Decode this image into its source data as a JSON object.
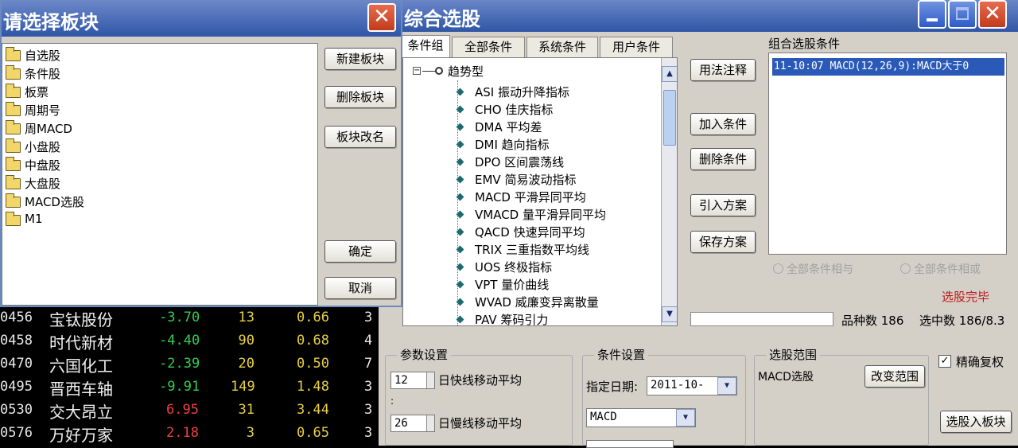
{
  "board_dialog": {
    "title": "请选择板块",
    "close_glyph": "✕",
    "folders": [
      "自选股",
      "条件股",
      "板票",
      "周期号",
      "周MACD",
      "小盘股",
      "中盘股",
      "大盘股",
      "MACD选股",
      "M1"
    ],
    "buttons": {
      "new": "新建板块",
      "delete": "删除板块",
      "rename": "板块改名",
      "ok": "确定",
      "cancel": "取消"
    }
  },
  "main_window": {
    "title": "综合选股",
    "tabs": [
      "条件组",
      "全部条件",
      "系统条件",
      "用户条件"
    ],
    "tree_root": "趋势型",
    "tree_items": [
      "ASI 振动升降指标",
      "CHO 佳庆指标",
      "DMA 平均差",
      "DMI 趋向指标",
      "DPO 区间震荡线",
      "EMV 简易波动指标",
      "MACD 平滑异同平均",
      "VMACD 量平滑异同平均",
      "QACD 快速异同平均",
      "TRIX 三重指数平均线",
      "UOS 终极指标",
      "VPT 量价曲线",
      "WVAD 威廉变异离散量",
      "PAV 筹码引力"
    ],
    "buttons": {
      "usage": "用法注释",
      "add_condition": "加入条件",
      "delete_condition": "删除条件",
      "import_plan": "引入方案",
      "save_plan": "保存方案"
    },
    "combo_label": "组合选股条件",
    "combo_items": [
      "11-10:07 MACD(12,26,9):MACD大于0"
    ],
    "radio_and": "全部条件相与",
    "radio_or": "全部条件相或",
    "select_done": "选股完毕",
    "stock_count": "品种数 186",
    "selected_count": "选中数 186/8.3",
    "params": {
      "title": "参数设置",
      "fast_value": "12",
      "fast_label": "日快线移动平均",
      "slow_value": "26",
      "slow_label": "日慢线移动平均",
      "separator": ":"
    },
    "cond_settings": {
      "title": "条件设置",
      "date_label": "指定日期:",
      "date_value": "2011-10-",
      "indicator_value": "MACD"
    },
    "range": {
      "title": "选股范围",
      "value": "MACD选股",
      "change_button": "改变范围"
    },
    "exact_restore": "精确复权",
    "checkbox_mark": "✓",
    "select_into_board": "选股入板块"
  },
  "stocks": [
    {
      "code": "0456",
      "name": "宝钛股份",
      "change": "-3.70",
      "vol": "13",
      "pct": "0.66",
      "x": "3",
      "color": "#30d050"
    },
    {
      "code": "0458",
      "name": "时代新材",
      "change": "-4.40",
      "vol": "90",
      "pct": "0.68",
      "x": "4",
      "color": "#30d050"
    },
    {
      "code": "0470",
      "name": "六国化工",
      "change": "-2.39",
      "vol": "20",
      "pct": "0.50",
      "x": "7",
      "color": "#30d050"
    },
    {
      "code": "0495",
      "name": "晋西车轴",
      "change": "-9.91",
      "vol": "149",
      "pct": "1.48",
      "x": "3",
      "color": "#30d050"
    },
    {
      "code": "0530",
      "name": "交大昂立",
      "change": "6.95",
      "vol": "31",
      "pct": "3.44",
      "x": "3",
      "color": "#f04040"
    },
    {
      "code": "0576",
      "name": "万好万家",
      "change": "2.18",
      "vol": "3",
      "pct": "0.65",
      "x": "3",
      "color": "#f04040"
    }
  ]
}
